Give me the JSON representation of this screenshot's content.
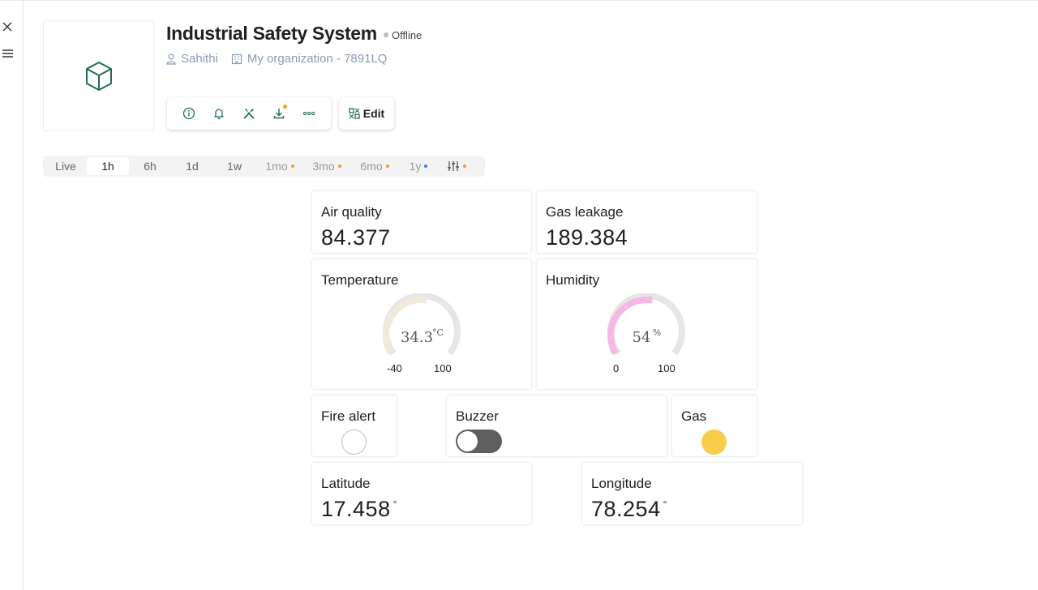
{
  "device": {
    "title": "Industrial Safety System",
    "status": "Offline",
    "owner": "Sahithi",
    "organization": "My organization - 7891LQ"
  },
  "toolbar": {
    "icons": [
      "info-icon",
      "bell-icon",
      "tools-icon",
      "download-icon",
      "more-icon"
    ],
    "edit_label": "Edit",
    "accent_color": "#1e6f4f"
  },
  "time_range": {
    "options": [
      {
        "label": "Live",
        "active": false
      },
      {
        "label": "1h",
        "active": true
      },
      {
        "label": "6h",
        "active": false
      },
      {
        "label": "1d",
        "active": false
      },
      {
        "label": "1w",
        "active": false
      },
      {
        "label": "1mo",
        "active": false,
        "dot_color": "#f59a23"
      },
      {
        "label": "3mo",
        "active": false,
        "dot_color": "#f59a23"
      },
      {
        "label": "6mo",
        "active": false,
        "dot_color": "#f59a23"
      },
      {
        "label": "1y",
        "active": false,
        "dot_color": "#3d7bf0"
      }
    ],
    "filter_icon": "sliders-icon",
    "filter_dot_color": "#f59a23"
  },
  "widgets": {
    "air_quality": {
      "label": "Air quality",
      "value": "84.377"
    },
    "gas_leakage": {
      "label": "Gas leakage",
      "value": "189.384"
    },
    "temperature": {
      "label": "Temperature",
      "value": "34.3",
      "unit": "°C",
      "min": "-40",
      "max": "100",
      "fraction": 0.534,
      "color": "#efeadb"
    },
    "humidity": {
      "label": "Humidity",
      "value": "54",
      "unit": "%",
      "min": "0",
      "max": "100",
      "fraction": 0.54,
      "color": "#f5b8e4"
    },
    "fire_alert": {
      "label": "Fire alert",
      "led_on": false
    },
    "buzzer": {
      "label": "Buzzer",
      "on": false
    },
    "gas": {
      "label": "Gas",
      "led_on": true,
      "led_color": "#f7cd4b"
    },
    "latitude": {
      "label": "Latitude",
      "value": "17.458",
      "unit": "°"
    },
    "longitude": {
      "label": "Longitude",
      "value": "78.254",
      "unit": "°"
    }
  }
}
